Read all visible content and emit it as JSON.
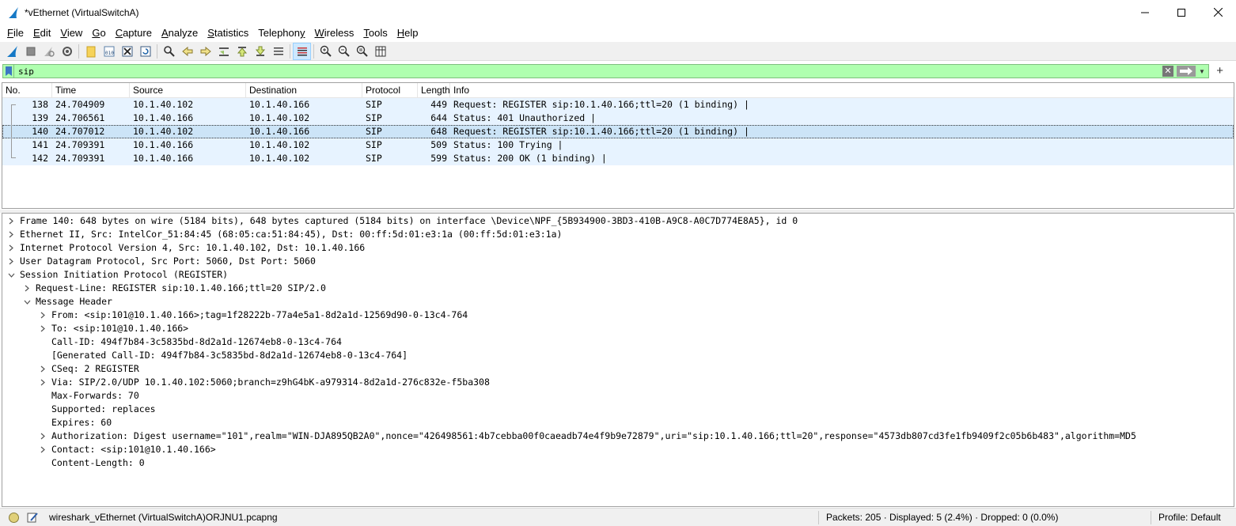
{
  "window": {
    "title": "*vEthernet (VirtualSwitchA)"
  },
  "menu": [
    {
      "label": "File",
      "ul": "F",
      "rest": "ile"
    },
    {
      "label": "Edit",
      "ul": "E",
      "rest": "dit"
    },
    {
      "label": "View",
      "ul": "V",
      "rest": "iew"
    },
    {
      "label": "Go",
      "ul": "G",
      "rest": "o"
    },
    {
      "label": "Capture",
      "ul": "C",
      "rest": "apture"
    },
    {
      "label": "Analyze",
      "ul": "A",
      "rest": "nalyze"
    },
    {
      "label": "Statistics",
      "ul": "S",
      "rest": "tatistics"
    },
    {
      "label": "Telephony",
      "ul": "",
      "rest": "Telephony",
      "ul_idx": 8
    },
    {
      "label": "Wireless",
      "ul": "W",
      "rest": "ireless"
    },
    {
      "label": "Tools",
      "ul": "T",
      "rest": "ools"
    },
    {
      "label": "Help",
      "ul": "H",
      "rest": "elp"
    }
  ],
  "filter": {
    "value": "sip"
  },
  "packet_list": {
    "columns": [
      "No.",
      "Time",
      "Source",
      "Destination",
      "Protocol",
      "Length",
      "Info"
    ],
    "rows": [
      {
        "no": "138",
        "time": "24.704909",
        "src": "10.1.40.102",
        "dst": "10.1.40.166",
        "proto": "SIP",
        "len": "449",
        "info": "Request: REGISTER sip:10.1.40.166;ttl=20  (1 binding) |"
      },
      {
        "no": "139",
        "time": "24.706561",
        "src": "10.1.40.166",
        "dst": "10.1.40.102",
        "proto": "SIP",
        "len": "644",
        "info": "Status: 401 Unauthorized |"
      },
      {
        "no": "140",
        "time": "24.707012",
        "src": "10.1.40.102",
        "dst": "10.1.40.166",
        "proto": "SIP",
        "len": "648",
        "info": "Request: REGISTER sip:10.1.40.166;ttl=20  (1 binding) |"
      },
      {
        "no": "141",
        "time": "24.709391",
        "src": "10.1.40.166",
        "dst": "10.1.40.102",
        "proto": "SIP",
        "len": "509",
        "info": "Status: 100 Trying |"
      },
      {
        "no": "142",
        "time": "24.709391",
        "src": "10.1.40.166",
        "dst": "10.1.40.102",
        "proto": "SIP",
        "len": "599",
        "info": "Status: 200 OK  (1 binding) |"
      }
    ]
  },
  "details": [
    {
      "level": 0,
      "arrow": "collapsed",
      "text": "Frame 140: 648 bytes on wire (5184 bits), 648 bytes captured (5184 bits) on interface \\Device\\NPF_{5B934900-3BD3-410B-A9C8-A0C7D774E8A5}, id 0"
    },
    {
      "level": 0,
      "arrow": "collapsed",
      "text": "Ethernet II, Src: IntelCor_51:84:45 (68:05:ca:51:84:45), Dst: 00:ff:5d:01:e3:1a (00:ff:5d:01:e3:1a)"
    },
    {
      "level": 0,
      "arrow": "collapsed",
      "text": "Internet Protocol Version 4, Src: 10.1.40.102, Dst: 10.1.40.166"
    },
    {
      "level": 0,
      "arrow": "collapsed",
      "text": "User Datagram Protocol, Src Port: 5060, Dst Port: 5060"
    },
    {
      "level": 0,
      "arrow": "expanded",
      "text": "Session Initiation Protocol (REGISTER)"
    },
    {
      "level": 1,
      "arrow": "collapsed",
      "text": "Request-Line: REGISTER sip:10.1.40.166;ttl=20 SIP/2.0"
    },
    {
      "level": 1,
      "arrow": "expanded",
      "text": "Message Header"
    },
    {
      "level": 2,
      "arrow": "collapsed",
      "text": "From: <sip:101@10.1.40.166>;tag=1f28222b-77a4e5a1-8d2a1d-12569d90-0-13c4-764"
    },
    {
      "level": 2,
      "arrow": "collapsed",
      "text": "To: <sip:101@10.1.40.166>"
    },
    {
      "level": 2,
      "arrow": "none",
      "text": "Call-ID: 494f7b84-3c5835bd-8d2a1d-12674eb8-0-13c4-764"
    },
    {
      "level": 2,
      "arrow": "none",
      "text": "[Generated Call-ID: 494f7b84-3c5835bd-8d2a1d-12674eb8-0-13c4-764]"
    },
    {
      "level": 2,
      "arrow": "collapsed",
      "text": "CSeq: 2 REGISTER"
    },
    {
      "level": 2,
      "arrow": "collapsed",
      "text": "Via: SIP/2.0/UDP 10.1.40.102:5060;branch=z9hG4bK-a979314-8d2a1d-276c832e-f5ba308"
    },
    {
      "level": 2,
      "arrow": "none",
      "text": "Max-Forwards: 70"
    },
    {
      "level": 2,
      "arrow": "none",
      "text": "Supported: replaces"
    },
    {
      "level": 2,
      "arrow": "none",
      "text": "Expires: 60"
    },
    {
      "level": 2,
      "arrow": "collapsed",
      "text": "Authorization: Digest username=\"101\",realm=\"WIN-DJA895QB2A0\",nonce=\"426498561:4b7cebba00f0caeadb74e4f9b9e72879\",uri=\"sip:10.1.40.166;ttl=20\",response=\"4573db807cd3fe1fb9409f2c05b6b483\",algorithm=MD5"
    },
    {
      "level": 2,
      "arrow": "collapsed",
      "text": "Contact: <sip:101@10.1.40.166>"
    },
    {
      "level": 2,
      "arrow": "none",
      "text": "Content-Length: 0"
    }
  ],
  "status": {
    "file": "wireshark_vEthernet (VirtualSwitchA)ORJNU1.pcapng",
    "packets": "Packets: 205 · Displayed: 5 (2.4%) · Dropped: 0 (0.0%)",
    "profile": "Profile: Default"
  },
  "icons": {
    "toolbar": [
      "shark-fin-start-icon",
      "stop-icon",
      "restart-icon",
      "options-gear-icon",
      "open-folder-icon",
      "save-file-icon",
      "close-file-icon",
      "reload-icon",
      "find-icon",
      "back-icon",
      "forward-icon",
      "goto-packet-icon",
      "first-packet-icon",
      "last-packet-icon",
      "autoscroll-icon",
      "colorize-icon",
      "zoom-in-icon",
      "zoom-out-icon",
      "zoom-normal-icon",
      "resize-columns-icon"
    ]
  },
  "colors": {
    "filter_ok": "#afffaf",
    "row_bg": "#e7f3ff",
    "row_selected": "#cce4f7"
  }
}
